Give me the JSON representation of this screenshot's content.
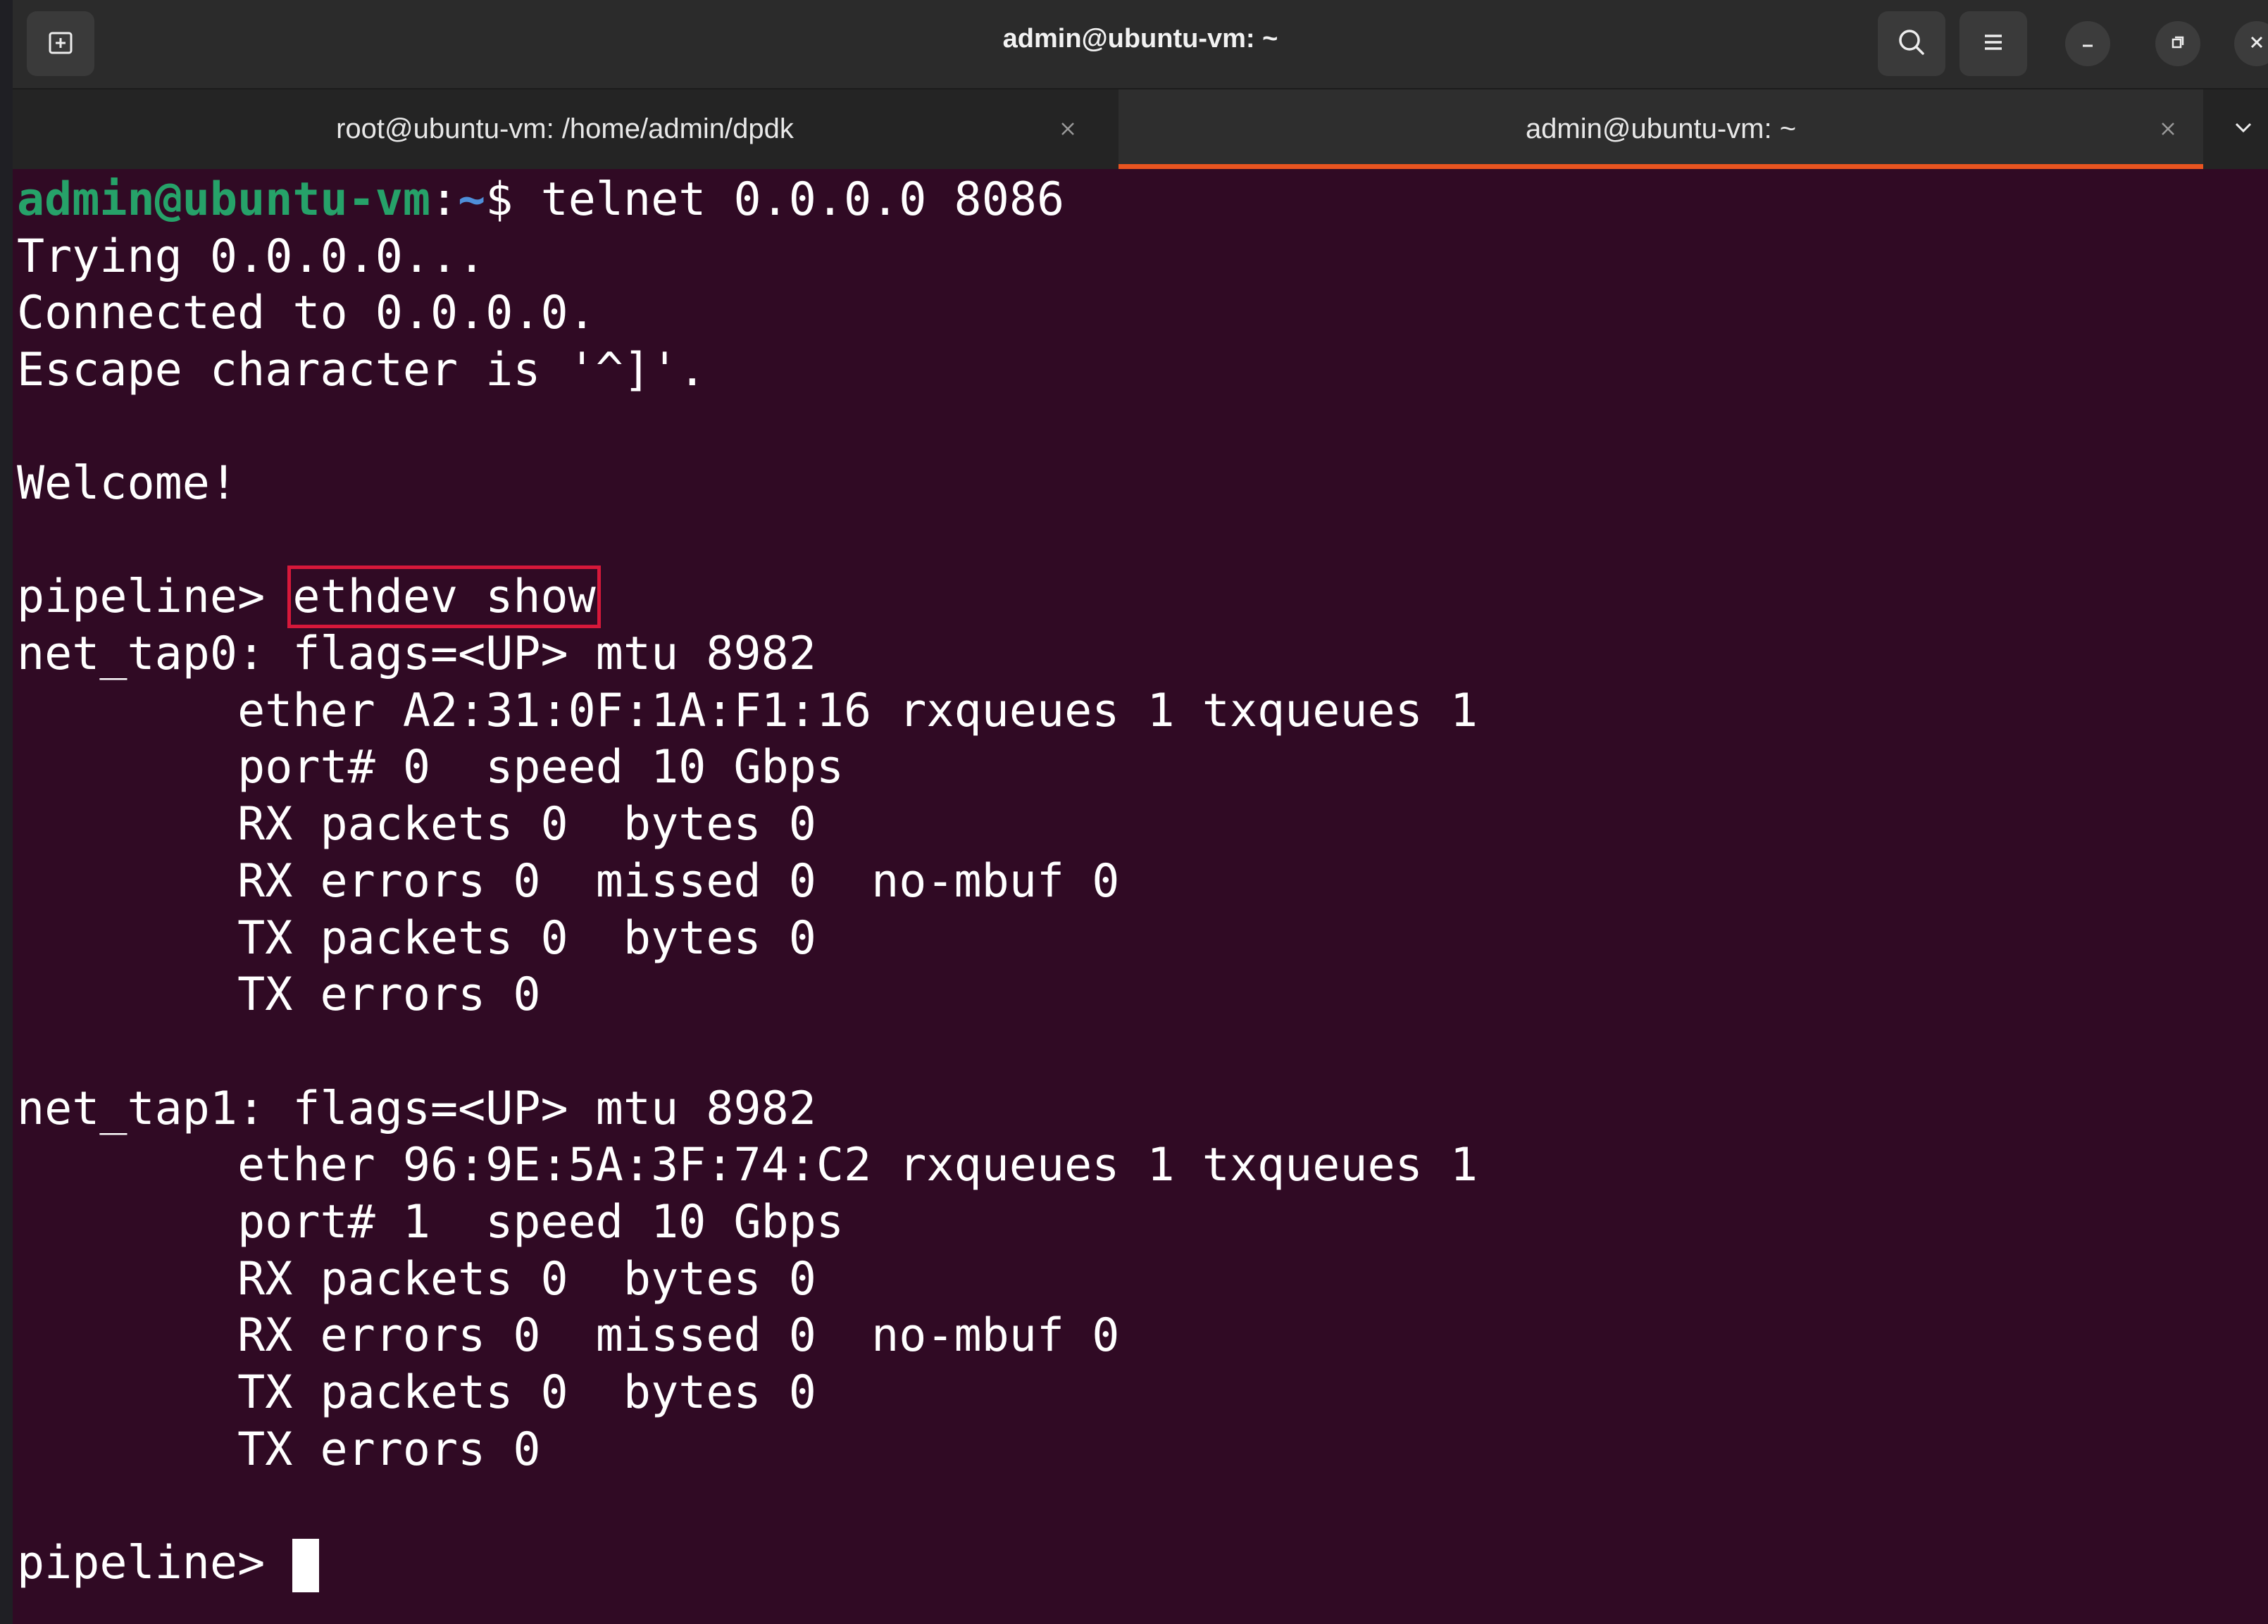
{
  "window": {
    "title": "admin@ubuntu-vm: ~"
  },
  "tabs": [
    {
      "label": "root@ubuntu-vm: /home/admin/dpdk",
      "active": false
    },
    {
      "label": "admin@ubuntu-vm: ~",
      "active": true
    }
  ],
  "icons": {
    "new_tab": "new-tab-icon",
    "search": "search-icon",
    "menu": "hamburger-menu-icon",
    "minimize": "minimize-icon",
    "maximize": "restore-icon",
    "close": "close-icon",
    "tab_close": "close-icon",
    "tabs_dropdown": "chevron-down-icon"
  },
  "colors": {
    "terminal_bg": "#300a24",
    "prompt_user": "#26a269",
    "prompt_path": "#4e8fd9",
    "active_tab_accent": "#e95420",
    "highlight_box": "#d6183a"
  },
  "terminal": {
    "prompt_user": "admin@ubuntu-vm",
    "prompt_colon": ":",
    "prompt_path": "~",
    "prompt_dollar": "$ ",
    "command": "telnet 0.0.0.0 8086",
    "lines": {
      "trying": "Trying 0.0.0.0...",
      "connected": "Connected to 0.0.0.0.",
      "escape": "Escape character is '^]'.",
      "welcome": "Welcome!",
      "pipeline_prompt": "pipeline> ",
      "ethdev_cmd": "ethdev show",
      "tap0_header": "net_tap0: flags=<UP> mtu 8982",
      "tap0_ether": "        ether A2:31:0F:1A:F1:16 rxqueues 1 txqueues 1",
      "tap0_port": "        port# 0  speed 10 Gbps",
      "tap0_rx_packets": "        RX packets 0  bytes 0",
      "tap0_rx_errors": "        RX errors 0  missed 0  no-mbuf 0",
      "tap0_tx_packets": "        TX packets 0  bytes 0",
      "tap0_tx_errors": "        TX errors 0",
      "tap1_header": "net_tap1: flags=<UP> mtu 8982",
      "tap1_ether": "        ether 96:9E:5A:3F:74:C2 rxqueues 1 txqueues 1",
      "tap1_port": "        port# 1  speed 10 Gbps",
      "tap1_rx_packets": "        RX packets 0  bytes 0",
      "tap1_rx_errors": "        RX errors 0  missed 0  no-mbuf 0",
      "tap1_tx_packets": "        TX packets 0  bytes 0",
      "tap1_tx_errors": "        TX errors 0",
      "final_prompt": "pipeline> "
    }
  }
}
